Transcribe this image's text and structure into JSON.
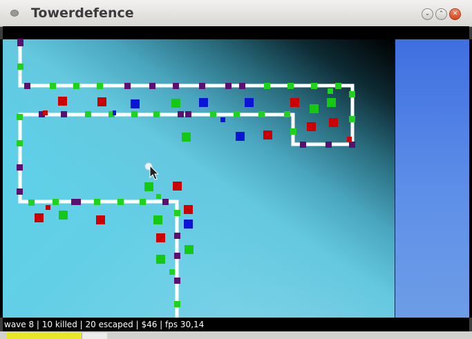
{
  "window": {
    "title": "Towerdefence",
    "buttons": {
      "minimize": "⌄",
      "maximize": "⌃",
      "close": "✕"
    }
  },
  "status": {
    "text": "wave 8 | 10 killed | 20 escaped | $46 | fps 30,14",
    "wave": 8,
    "killed": 10,
    "escaped": 20,
    "money": 46,
    "fps": "30,14"
  },
  "colors": {
    "tower_red": "#cc0000",
    "tower_blue": "#0a14d4",
    "tower_green": "#14c814",
    "creep_green": "#1ed21e",
    "creep_purple": "#5a1070",
    "path": "#ffffff",
    "panel": "#4f7fe4"
  },
  "icons": {
    "window_menu": "window-menu-icon",
    "cursor": "mouse-pointer-icon",
    "placement_ghost": "placement-ghost-icon"
  }
}
